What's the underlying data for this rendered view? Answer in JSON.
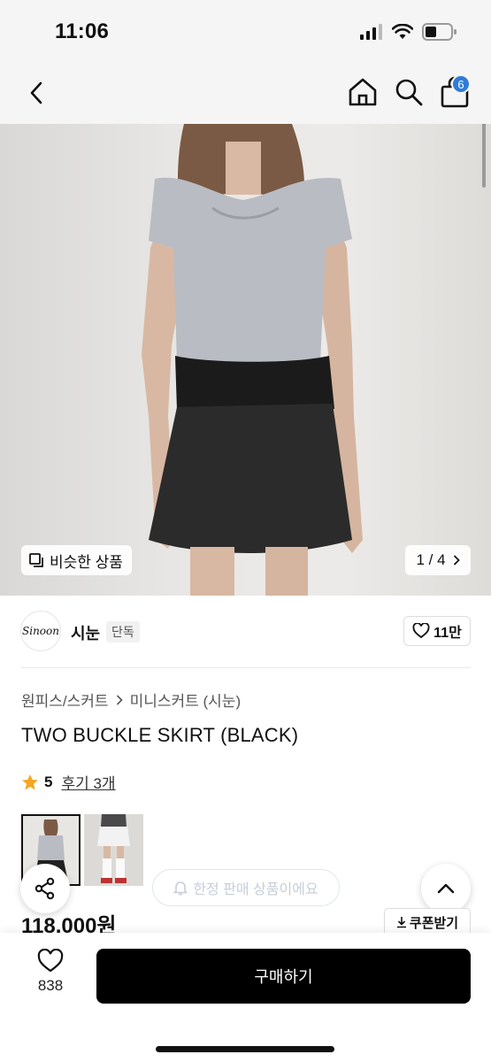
{
  "status": {
    "time": "11:06"
  },
  "nav": {
    "cart_count": "6"
  },
  "hero": {
    "similar_label": "비슷한 상품",
    "page_counter": "1 / 4"
  },
  "brand": {
    "logo_text": "Sinoon",
    "name": "시눈",
    "tag": "단독",
    "likes": "11만"
  },
  "product": {
    "breadcrumb": [
      "원피스/스커트",
      "미니스커트 (시눈)"
    ],
    "title": "TWO BUCKLE SKIRT (BLACK)",
    "rating": "5",
    "reviews": "후기 3개",
    "limited": "한정 판매 상품이에요",
    "price": "118,000원",
    "coupon": "쿠폰받기"
  },
  "bottom": {
    "wish_count": "838",
    "buy_label": "구매하기"
  },
  "colors": {
    "badge": "#2f7bd9",
    "star": "#f5a623",
    "buy_bg": "#000000"
  }
}
